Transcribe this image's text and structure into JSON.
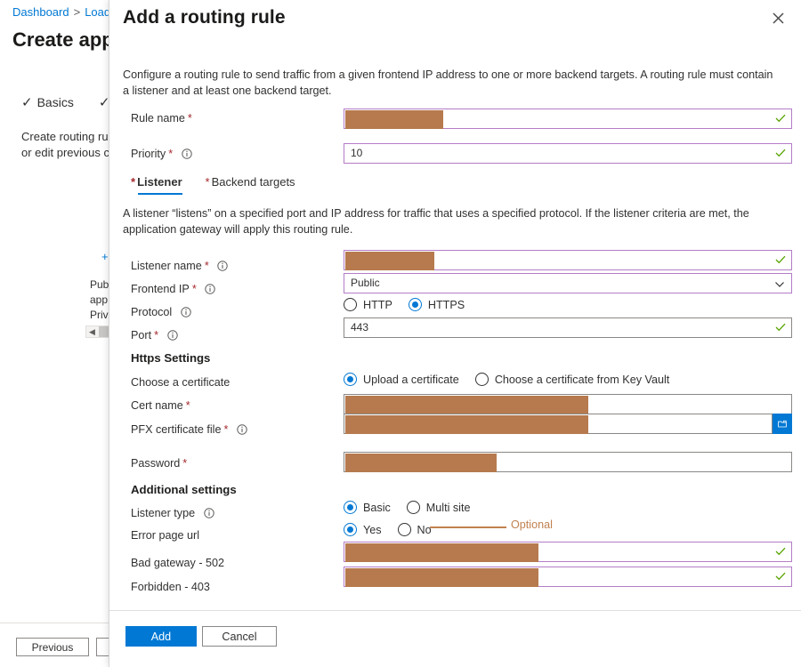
{
  "background": {
    "breadcrumb": [
      "Dashboard",
      "Load"
    ],
    "page_title": "Create app",
    "steps": [
      "Basics"
    ],
    "note_line1": "Create routing rule",
    "note_line2": "or edit previous co",
    "plus": "+",
    "col_labels": [
      "Pub",
      "app",
      "Priv"
    ],
    "previous_label": "Previous",
    "next_label": ""
  },
  "panel": {
    "title": "Add a routing rule",
    "close_icon": "close-icon",
    "description": "Configure a routing rule to send traffic from a given frontend IP address to one or more backend targets. A routing rule must contain a listener and at least one backend target.",
    "rule_name": {
      "label": "Rule name",
      "required": "*",
      "value": ""
    },
    "priority": {
      "label": "Priority",
      "required": "*",
      "value": "10",
      "info_icon": "info-icon"
    },
    "tabs": [
      {
        "label": "Listener",
        "required": "*",
        "active": true
      },
      {
        "label": "Backend targets",
        "required": "*",
        "active": false
      }
    ],
    "listener_description": "A listener “listens” on a specified port and IP address for traffic that uses a specified protocol. If the listener criteria are met, the application gateway will apply this routing rule.",
    "listener_name": {
      "label": "Listener name",
      "required": "*",
      "value": "",
      "info_icon": "info-icon"
    },
    "frontend_ip": {
      "label": "Frontend IP",
      "required": "*",
      "value": "Public",
      "info_icon": "info-icon",
      "caret_icon": "chevron-down-icon"
    },
    "protocol": {
      "label": "Protocol",
      "info_icon": "info-icon",
      "options": [
        {
          "label": "HTTP",
          "selected": false
        },
        {
          "label": "HTTPS",
          "selected": true
        }
      ]
    },
    "port": {
      "label": "Port",
      "required": "*",
      "value": "443",
      "info_icon": "info-icon"
    },
    "https_settings_header": "Https Settings",
    "choose_certificate": {
      "label": "Choose a certificate",
      "options": [
        {
          "label": "Upload a certificate",
          "selected": true
        },
        {
          "label": "Choose a certificate from Key Vault",
          "selected": false
        }
      ]
    },
    "cert_name": {
      "label": "Cert name",
      "required": "*",
      "value": ""
    },
    "pfx_certificate_file": {
      "label": "PFX certificate file",
      "required": "*",
      "value": "",
      "info_icon": "info-icon",
      "browse_icon": "folder-icon"
    },
    "password": {
      "label": "Password",
      "required": "*",
      "value": ""
    },
    "additional_settings_header": "Additional settings",
    "listener_type": {
      "label": "Listener type",
      "info_icon": "info-icon",
      "options": [
        {
          "label": "Basic",
          "selected": true
        },
        {
          "label": "Multi site",
          "selected": false
        }
      ]
    },
    "error_page_url": {
      "label": "Error page url",
      "optional_text": "Optional",
      "options": [
        {
          "label": "Yes",
          "selected": true
        },
        {
          "label": "No",
          "selected": false
        }
      ]
    },
    "bad_gateway": {
      "label": "Bad gateway - 502",
      "value": ""
    },
    "forbidden": {
      "label": "Forbidden - 403",
      "value": ""
    },
    "footer": {
      "add_label": "Add",
      "cancel_label": "Cancel"
    }
  },
  "colors": {
    "accent": "#0078d4",
    "required_asterisk": "#a4262c",
    "valid_border": "#b47cc7",
    "redaction": "#b67a4e",
    "optional": "#c1814f",
    "check_green": "#57a300"
  }
}
